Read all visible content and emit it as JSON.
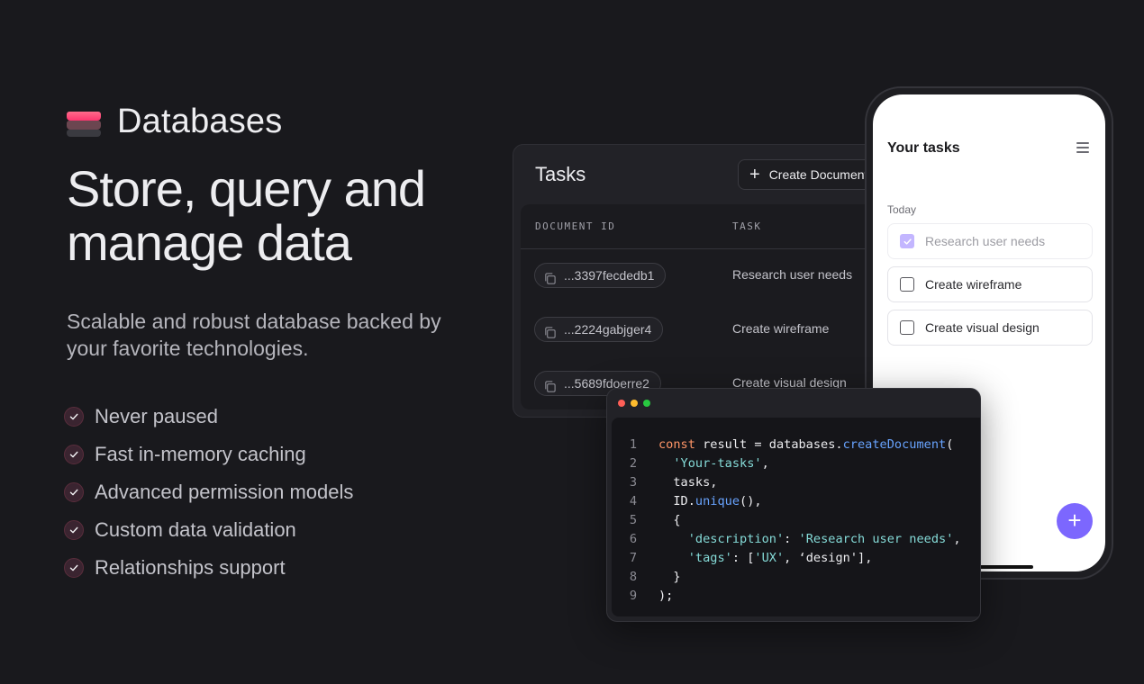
{
  "hero": {
    "brand": "Databases",
    "headline_line1": "Store, query and",
    "headline_line2": "manage data",
    "subtitle": "Scalable and robust database backed by your favorite technologies.",
    "features": [
      "Never paused",
      "Fast in-memory caching",
      "Advanced permission models",
      "Custom data validation",
      "Relationships support"
    ]
  },
  "table": {
    "title": "Tasks",
    "create_label": "Create Document",
    "columns": [
      "DOCUMENT ID",
      "TASK"
    ],
    "rows": [
      {
        "id": "...3397fecdedb1",
        "task": "Research user needs"
      },
      {
        "id": "...2224gabjger4",
        "task": "Create wireframe"
      },
      {
        "id": "...5689fdoerre2",
        "task": "Create visual design"
      }
    ]
  },
  "phone": {
    "title": "Your tasks",
    "section": "Today",
    "tasks": [
      {
        "label": "Research user needs",
        "checked": true
      },
      {
        "label": "Create wireframe",
        "checked": false
      },
      {
        "label": "Create visual design",
        "checked": false
      }
    ],
    "fab_label": "+"
  },
  "code": {
    "lines": [
      [
        {
          "t": "kw",
          "v": "const"
        },
        {
          "t": "pl",
          "v": " result = databases."
        },
        {
          "t": "fn",
          "v": "createDocument"
        },
        {
          "t": "pl",
          "v": "("
        }
      ],
      [
        {
          "t": "pl",
          "v": "  "
        },
        {
          "t": "str",
          "v": "'Your-tasks'"
        },
        {
          "t": "pl",
          "v": ","
        }
      ],
      [
        {
          "t": "pl",
          "v": "  tasks,"
        }
      ],
      [
        {
          "t": "pl",
          "v": "  ID."
        },
        {
          "t": "fn",
          "v": "unique"
        },
        {
          "t": "pl",
          "v": "(),"
        }
      ],
      [
        {
          "t": "pl",
          "v": "  {"
        }
      ],
      [
        {
          "t": "pl",
          "v": "    "
        },
        {
          "t": "str",
          "v": "'description'"
        },
        {
          "t": "pl",
          "v": ": "
        },
        {
          "t": "str",
          "v": "'Research user needs'"
        },
        {
          "t": "pl",
          "v": ","
        }
      ],
      [
        {
          "t": "pl",
          "v": "    "
        },
        {
          "t": "str",
          "v": "'tags'"
        },
        {
          "t": "pl",
          "v": ": ["
        },
        {
          "t": "str",
          "v": "'UX'"
        },
        {
          "t": "pl",
          "v": ", ‘design'],"
        }
      ],
      [
        {
          "t": "pl",
          "v": "  }"
        }
      ],
      [
        {
          "t": "pl",
          "v": ");"
        }
      ]
    ]
  },
  "colors": {
    "accent": "#fd366e",
    "fab": "#7c67fe",
    "window_dots": [
      "#ff5f57",
      "#febc2e",
      "#28c840"
    ]
  }
}
